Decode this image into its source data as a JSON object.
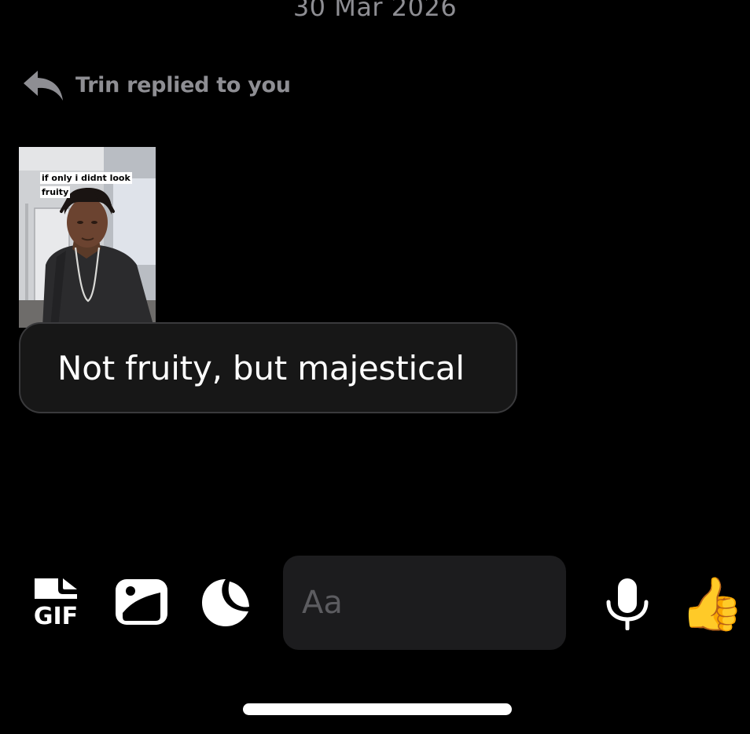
{
  "conversation": {
    "date_separator": "30 Mar 2026"
  },
  "reply": {
    "header_text": "Trin replied to you",
    "icon": "reply-arrow-icon",
    "story": {
      "caption_line1": "if only i didnt look",
      "caption_line2": "fruity"
    },
    "message_text": "Not fruity, but majestical"
  },
  "composer": {
    "gif_icon": "gif-icon",
    "gif_label": "GIF",
    "image_icon": "image-icon",
    "sticker_icon": "sticker-icon",
    "input_placeholder": "Aa",
    "input_value": "",
    "mic_icon": "microphone-icon",
    "like_icon": "thumbs-up-icon",
    "like_glyph": "👍"
  },
  "colors": {
    "background": "#000000",
    "muted_text": "#8e8e93",
    "bubble_bg": "#171717",
    "bubble_border": "#3a3a3c",
    "input_bg": "#1c1c1e",
    "icon_fill": "#ffffff"
  }
}
